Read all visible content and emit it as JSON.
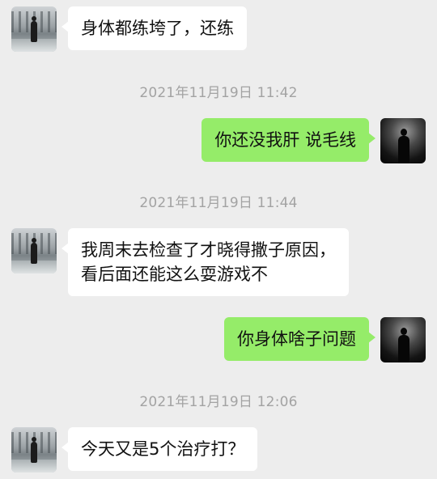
{
  "chat": {
    "messages": [
      {
        "side": "left",
        "text": "身体都练垮了，还练"
      },
      {
        "type": "time",
        "text": "2021年11月19日 11:42"
      },
      {
        "side": "right",
        "text": "你还没我肝 说毛线"
      },
      {
        "type": "time",
        "text": "2021年11月19日 11:44"
      },
      {
        "side": "left",
        "lines": [
          "我周末去检查了才晓得撒子原因，",
          "看后面还能这么耍游戏不"
        ]
      },
      {
        "side": "right",
        "text": "你身体啥子问题"
      },
      {
        "type": "time",
        "text": "2021年11月19日 12:06"
      },
      {
        "side": "left",
        "text": "今天又是5个治疗打？"
      }
    ]
  },
  "colors": {
    "background": "#ededed",
    "incoming_bubble": "#ffffff",
    "outgoing_bubble": "#95ec69",
    "timestamp": "#a3a3a3"
  },
  "icons": {
    "friend_avatar": "person-in-park-avatar",
    "self_avatar": "dark-silhouette-avatar"
  }
}
